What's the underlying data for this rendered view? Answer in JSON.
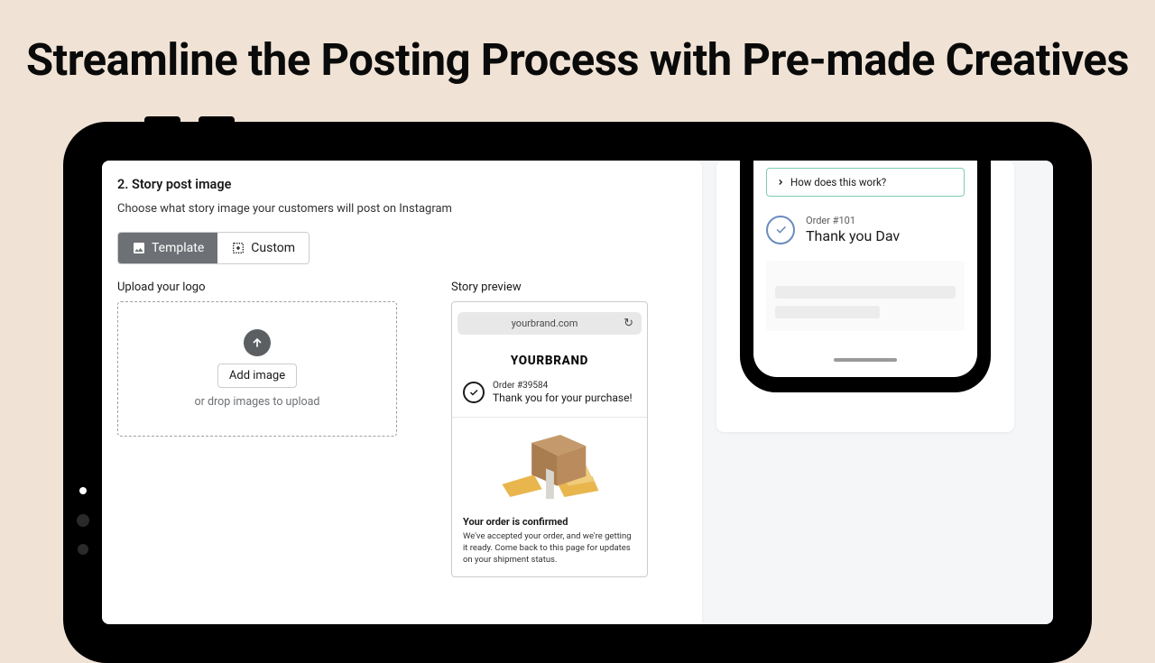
{
  "headline": "Streamline the Posting Process with Pre-made Creatives",
  "section": {
    "title": "2. Story post image",
    "subtitle": "Choose what story image your customers will post on Instagram"
  },
  "toggle": {
    "template": "Template",
    "custom": "Custom"
  },
  "upload": {
    "label": "Upload your logo",
    "button": "Add image",
    "hint": "or drop images to upload"
  },
  "preview": {
    "label": "Story preview",
    "domain": "yourbrand.com",
    "brand": "YOURBRAND",
    "order_num": "Order #39584",
    "thank": "Thank you for your purchase!",
    "confirm_h": "Your order is confirmed",
    "confirm_p": "We've accepted your order, and we're getting it ready. Come back to this page for updates on your shipment status."
  },
  "phone": {
    "how": "How does this work?",
    "order_num": "Order #101",
    "thank": "Thank you Dav"
  }
}
